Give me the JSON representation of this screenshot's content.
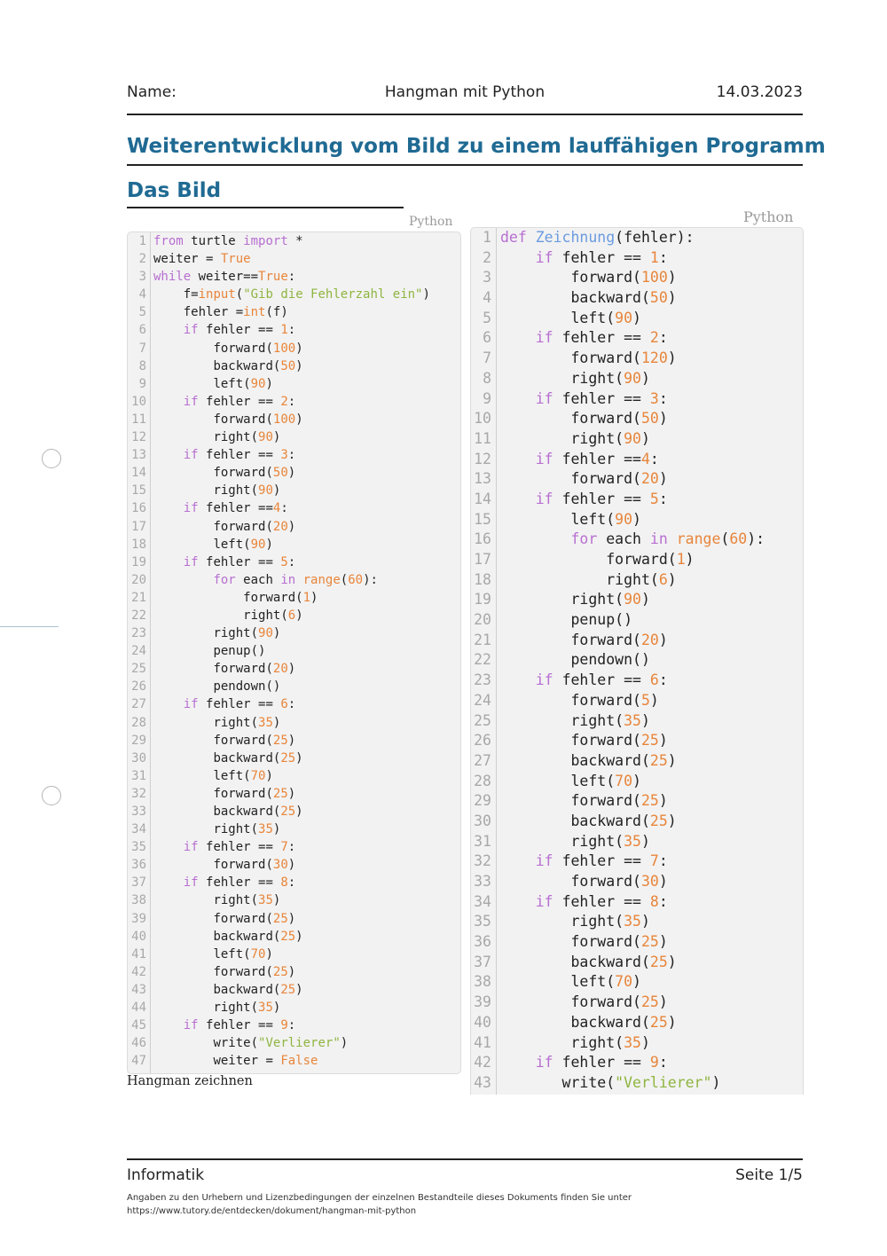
{
  "header": {
    "name_label": "Name:",
    "title": "Hangman mit Python",
    "date": "14.03.2023"
  },
  "main_title": "Weiterentwicklung vom Bild zu einem lauffähigen Programm",
  "section_title": "Das Bild",
  "left_code": {
    "language": "Python",
    "caption": "Hangman zeichnen",
    "lines": [
      "from turtle import *",
      "weiter = True",
      "while weiter==True:",
      "    f=input(\"Gib die Fehlerzahl ein\")",
      "    fehler =int(f)",
      "    if fehler == 1:",
      "        forward(100)",
      "        backward(50)",
      "        left(90)",
      "    if fehler == 2:",
      "        forward(100)",
      "        right(90)",
      "    if fehler == 3:",
      "        forward(50)",
      "        right(90)",
      "    if fehler ==4:",
      "        forward(20)",
      "        left(90)",
      "    if fehler == 5:",
      "        for each in range(60):",
      "            forward(1)",
      "            right(6)",
      "        right(90)",
      "        penup()",
      "        forward(20)",
      "        pendown()",
      "    if fehler == 6:",
      "        right(35)",
      "        forward(25)",
      "        backward(25)",
      "        left(70)",
      "        forward(25)",
      "        backward(25)",
      "        right(35)",
      "    if fehler == 7:",
      "        forward(30)",
      "    if fehler == 8:",
      "        right(35)",
      "        forward(25)",
      "        backward(25)",
      "        left(70)",
      "        forward(25)",
      "        backward(25)",
      "        right(35)",
      "    if fehler == 9:",
      "        write(\"Verlierer\")",
      "        weiter = False"
    ]
  },
  "right_code": {
    "language": "Python",
    "lines": [
      "def Zeichnung(fehler):",
      "    if fehler == 1:",
      "        forward(100)",
      "        backward(50)",
      "        left(90)",
      "    if fehler == 2:",
      "        forward(120)",
      "        right(90)",
      "    if fehler == 3:",
      "        forward(50)",
      "        right(90)",
      "    if fehler ==4:",
      "        forward(20)",
      "    if fehler == 5:",
      "        left(90)",
      "        for each in range(60):",
      "            forward(1)",
      "            right(6)",
      "        right(90)",
      "        penup()",
      "        forward(20)",
      "        pendown()",
      "    if fehler == 6:",
      "        forward(5)",
      "        right(35)",
      "        forward(25)",
      "        backward(25)",
      "        left(70)",
      "        forward(25)",
      "        backward(25)",
      "        right(35)",
      "    if fehler == 7:",
      "        forward(30)",
      "    if fehler == 8:",
      "        right(35)",
      "        forward(25)",
      "        backward(25)",
      "        left(70)",
      "        forward(25)",
      "        backward(25)",
      "        right(35)",
      "    if fehler == 9:",
      "       write(\"Verlierer\")"
    ]
  },
  "syntax_colors": {
    "keyword": "#b76fd0",
    "number": "#e8853a",
    "string": "#8fb540",
    "function_name": "#6a9be0",
    "text": "#222222",
    "line_number": "#a8a8a8"
  },
  "footer": {
    "subject": "Informatik",
    "page": "Seite 1/5",
    "attribution_line1": "Angaben zu den Urhebern und Lizenzbedingungen der einzelnen Bestandteile dieses Dokuments finden Sie unter",
    "attribution_line2": "https://www.tutory.de/entdecken/dokument/hangman-mit-python"
  }
}
